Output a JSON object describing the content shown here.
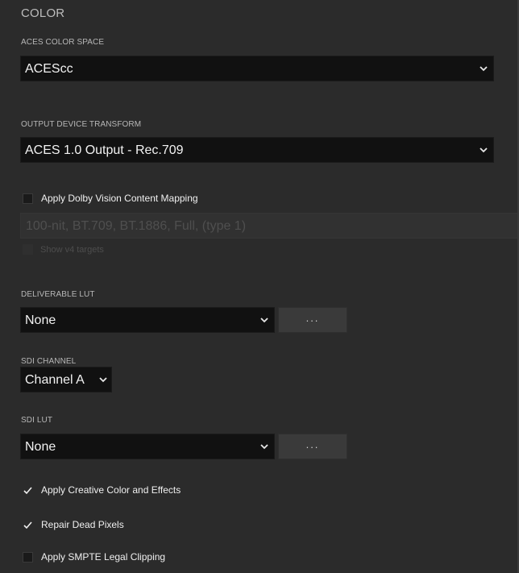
{
  "section": {
    "title": "COLOR"
  },
  "aces_color_space": {
    "label": "ACES COLOR SPACE",
    "value": "ACEScc"
  },
  "output_device_transform": {
    "label": "OUTPUT DEVICE TRANSFORM",
    "value": "ACES 1.0 Output - Rec.709"
  },
  "dolby": {
    "checkbox_label": "Apply Dolby Vision Content Mapping",
    "checked": false,
    "target_value": "100-nit, BT.709, BT.1886, Full, (type 1)",
    "show_v4_label": "Show v4 targets"
  },
  "deliverable_lut": {
    "label": "DELIVERABLE LUT",
    "value": "None",
    "more_label": "..."
  },
  "sdi_channel": {
    "label": "SDI CHANNEL",
    "value": "Channel A"
  },
  "sdi_lut": {
    "label": "SDI LUT",
    "value": "None",
    "more_label": "..."
  },
  "options": [
    {
      "label": "Apply Creative Color and Effects",
      "checked": true
    },
    {
      "label": "Repair Dead Pixels",
      "checked": true
    },
    {
      "label": "Apply SMPTE Legal Clipping",
      "checked": false
    }
  ],
  "icons": {
    "dropdown": "chevron-down-icon",
    "check": "checkmark-icon"
  },
  "colors": {
    "background": "#2b2b2b",
    "field": "#111111",
    "button": "#3a3a3a",
    "text": "#f2f2f2",
    "disabled_text": "#4f4f4f"
  }
}
